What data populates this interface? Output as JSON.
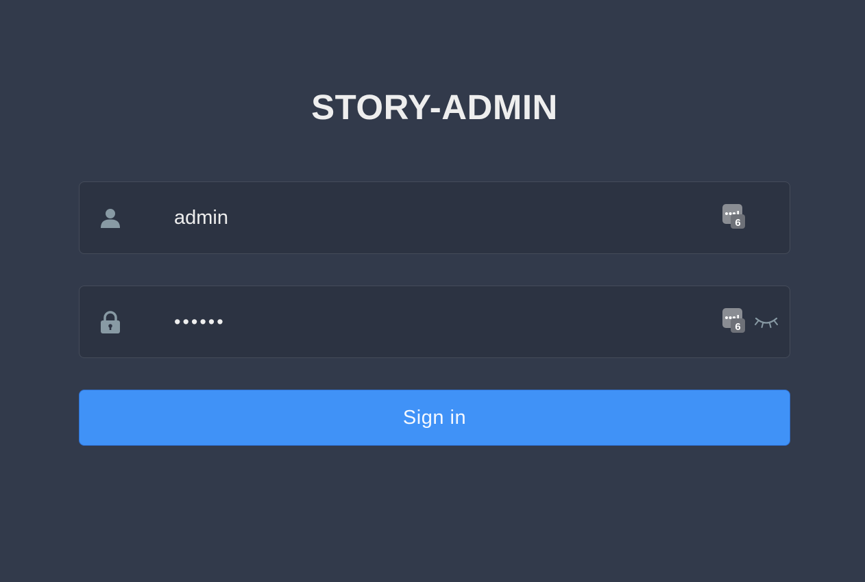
{
  "page": {
    "title": "STORY-ADMIN"
  },
  "username": {
    "value": "admin",
    "icon": "user-icon"
  },
  "password": {
    "value": "••••••",
    "icon": "lock-icon",
    "toggle_icon": "eye-closed-icon"
  },
  "password_manager": {
    "icon": "password-manager-icon",
    "badge": "6"
  },
  "login_button": {
    "label": "Sign in"
  },
  "colors": {
    "background": "#323a4b",
    "field_background": "#2c3342",
    "field_border": "#454c5a",
    "button": "#4092f7",
    "text": "#eeeeee",
    "icon": "#889aa4"
  }
}
